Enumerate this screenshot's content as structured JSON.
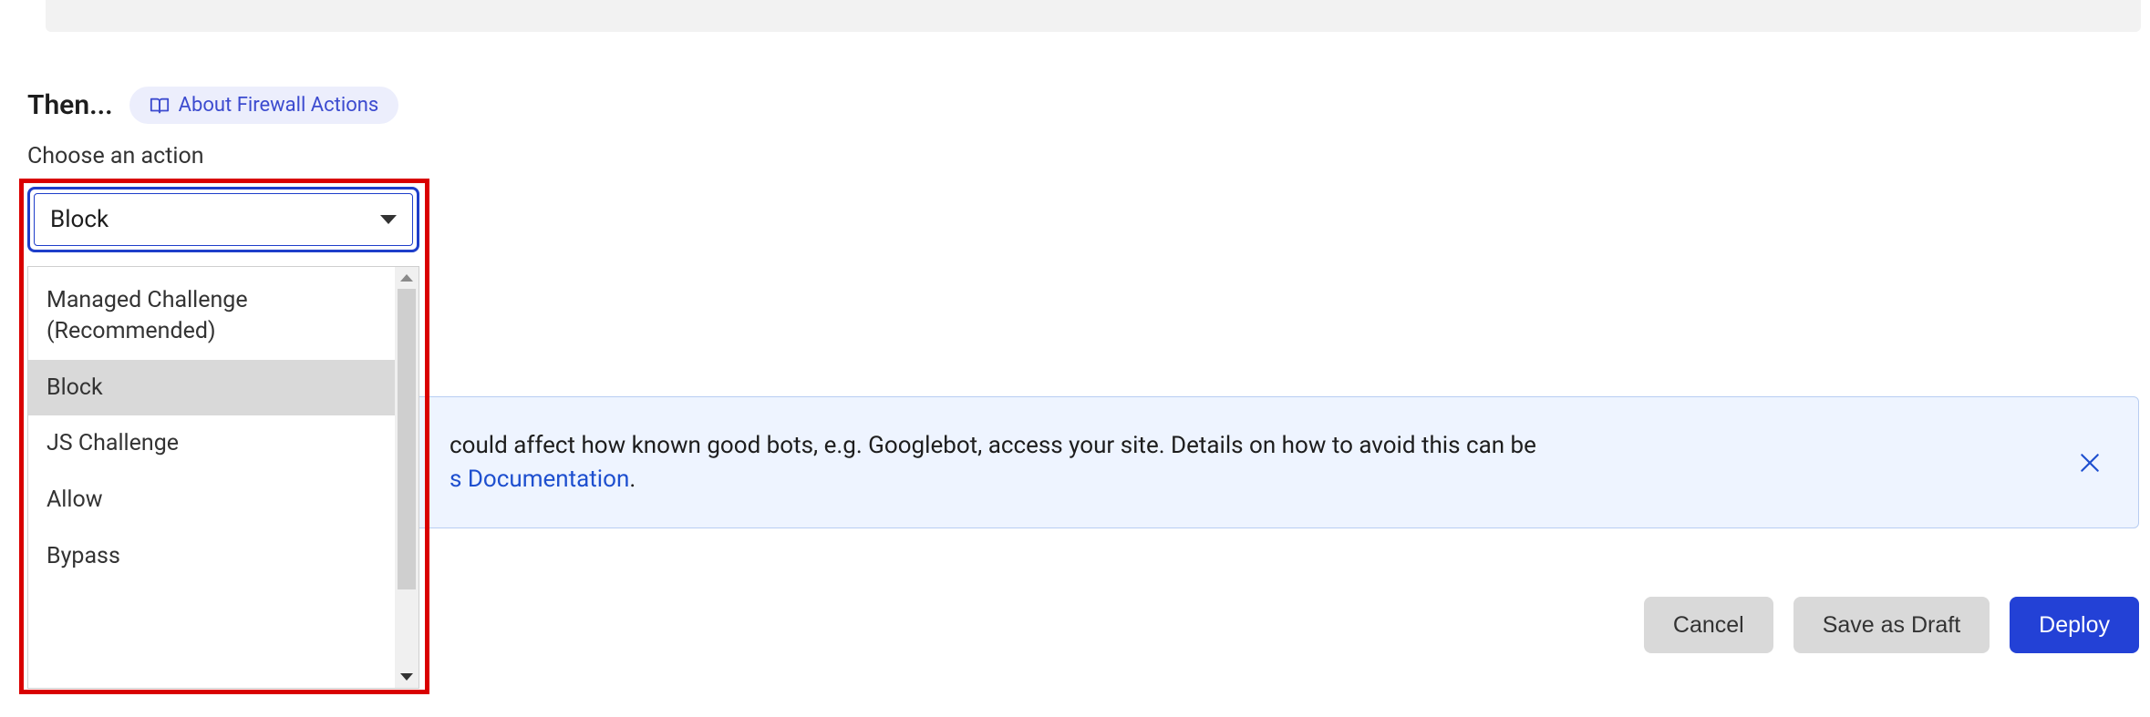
{
  "header": {
    "then_label": "Then...",
    "about_link": "About Firewall Actions"
  },
  "action": {
    "choose_label": "Choose an action",
    "selected": "Block",
    "options": [
      "Managed Challenge (Recommended)",
      "Block",
      "JS Challenge",
      "Allow",
      "Bypass"
    ],
    "selected_index": 1
  },
  "banner": {
    "text_visible_1": " could affect how known good bots, e.g. Googlebot, access your site. Details on how to avoid this can be",
    "link_fragment": "s Documentation",
    "period": "."
  },
  "footer": {
    "cancel": "Cancel",
    "save_draft": "Save as Draft",
    "deploy": "Deploy"
  }
}
